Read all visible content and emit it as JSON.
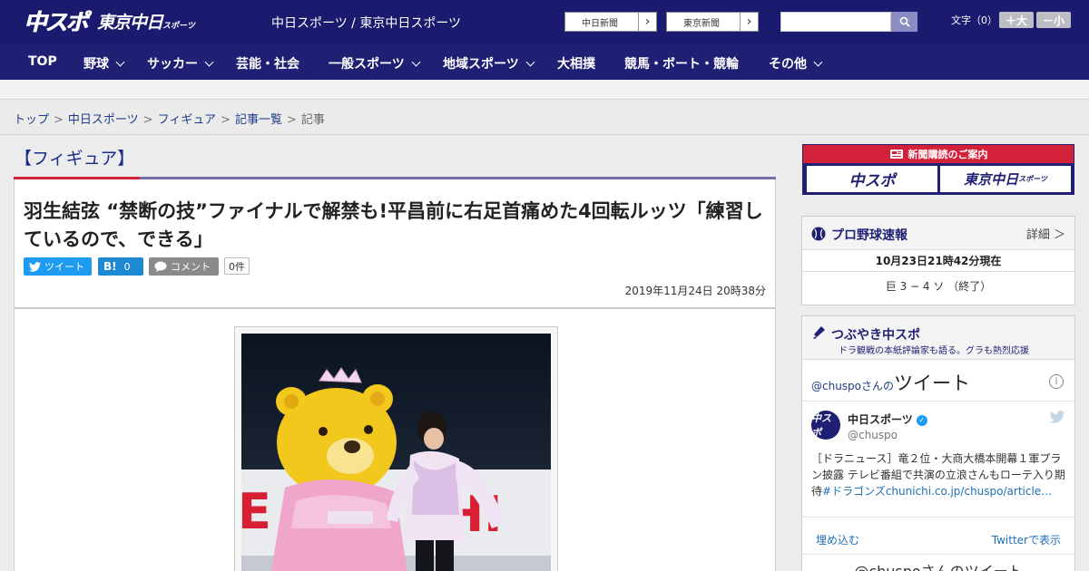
{
  "header": {
    "logo_main": "中スポ",
    "logo_tokyo": "東京中日",
    "logo_tokyo_small": "スポーツ",
    "site_title": "中日スポーツ / 東京中日スポーツ",
    "paper_buttons": [
      "中日新聞",
      "東京新聞"
    ],
    "search_placeholder": "",
    "font_size_label": "文字（0）",
    "font_larger": "＋大",
    "font_smaller": "－小",
    "colors": {
      "header_bg": "#1a1a6e",
      "nav_bg": "#1f1f74",
      "accent_red": "#d4213a"
    }
  },
  "nav": {
    "items": [
      {
        "label": "TOP",
        "dropdown": false
      },
      {
        "label": "野球",
        "dropdown": true
      },
      {
        "label": "サッカー",
        "dropdown": true
      },
      {
        "label": "芸能・社会",
        "dropdown": false
      },
      {
        "label": "一般スポーツ",
        "dropdown": true
      },
      {
        "label": "地域スポーツ",
        "dropdown": true
      },
      {
        "label": "大相撲",
        "dropdown": false
      },
      {
        "label": "競馬・ボート・競輪",
        "dropdown": false
      },
      {
        "label": "その他",
        "dropdown": true
      }
    ]
  },
  "breadcrumb": {
    "items": [
      "トップ",
      "中日スポーツ",
      "フィギュア",
      "記事一覧"
    ],
    "current": "記事"
  },
  "article": {
    "category": "【フィギュア】",
    "headline": "羽生結弦 “禁断の技”ファイナルで解禁も!平昌前に右足首痛めた4回転ルッツ「練習しているので、できる」",
    "share": {
      "tweet": "ツイート",
      "hatena_label": "B!",
      "hatena_count": "0",
      "comment": "コメント",
      "comment_count": "0件"
    },
    "date": "2019年11月24日 20時38分"
  },
  "sidebar": {
    "subscription": {
      "title": "新聞購読のご案内",
      "logos": [
        "中スポ",
        "東京中日"
      ],
      "logo_small": "スポーツ"
    },
    "baseball": {
      "title": "プロ野球速報",
      "detail": "詳細 ＞",
      "updated": "10月23日21時42分現在",
      "score": "巨 3 − 4 ソ （終了）"
    },
    "tweets": {
      "title": "つぶやき中スポ",
      "subtitle": "ドラ観戦の本紙評論家も語る。グラも熱烈応援",
      "embed_prefix": "@chuspoさんの",
      "embed_title": "ツイート",
      "info": "i",
      "avatar": "中スポ",
      "name": "中日スポーツ",
      "handle": "@chuspo",
      "text": "［ドラニュース］竜２位・大商大橋本開幕１軍プラン披露 テレビ番組で共演の立浪さんもローテ入り期待",
      "link": "#ドラゴンズchunichi.co.jp/chuspo/article…",
      "embed_link": "埋め込む",
      "view_link": "Twitterで表示",
      "more": "@chuspoさんのツイート"
    }
  }
}
